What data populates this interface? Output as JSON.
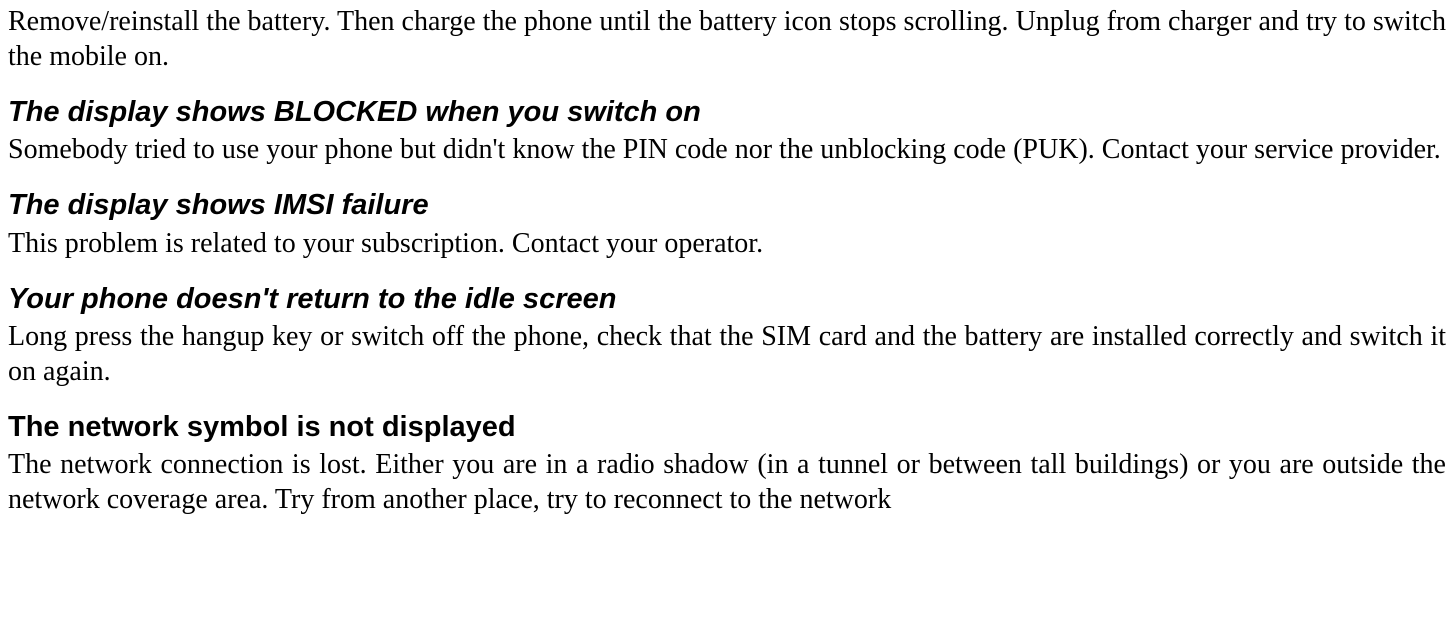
{
  "intro_paragraph": "Remove/reinstall the battery. Then charge the phone until the battery icon stops scrolling. Unplug from charger and try to switch the mobile on.",
  "sections": [
    {
      "heading": "The display shows BLOCKED when you switch on",
      "body": "Somebody tried to use your phone but didn't know the PIN code nor the unblocking code (PUK). Contact your service provider.",
      "italic": true
    },
    {
      "heading": "The display shows IMSI failure",
      "body": "This problem is related to your subscription. Contact your operator.",
      "italic": true
    },
    {
      "heading": "Your phone doesn't return to the idle screen",
      "body": "Long press the hangup key or switch off the phone, check that the SIM card and the battery are installed correctly and switch it on again.",
      "italic": true
    },
    {
      "heading": "The network symbol is not displayed",
      "body": "The network connection is lost. Either you are in a radio shadow (in a tunnel or between tall buildings) or you are outside the network coverage area. Try from another place, try to reconnect to the network",
      "italic": false
    }
  ]
}
